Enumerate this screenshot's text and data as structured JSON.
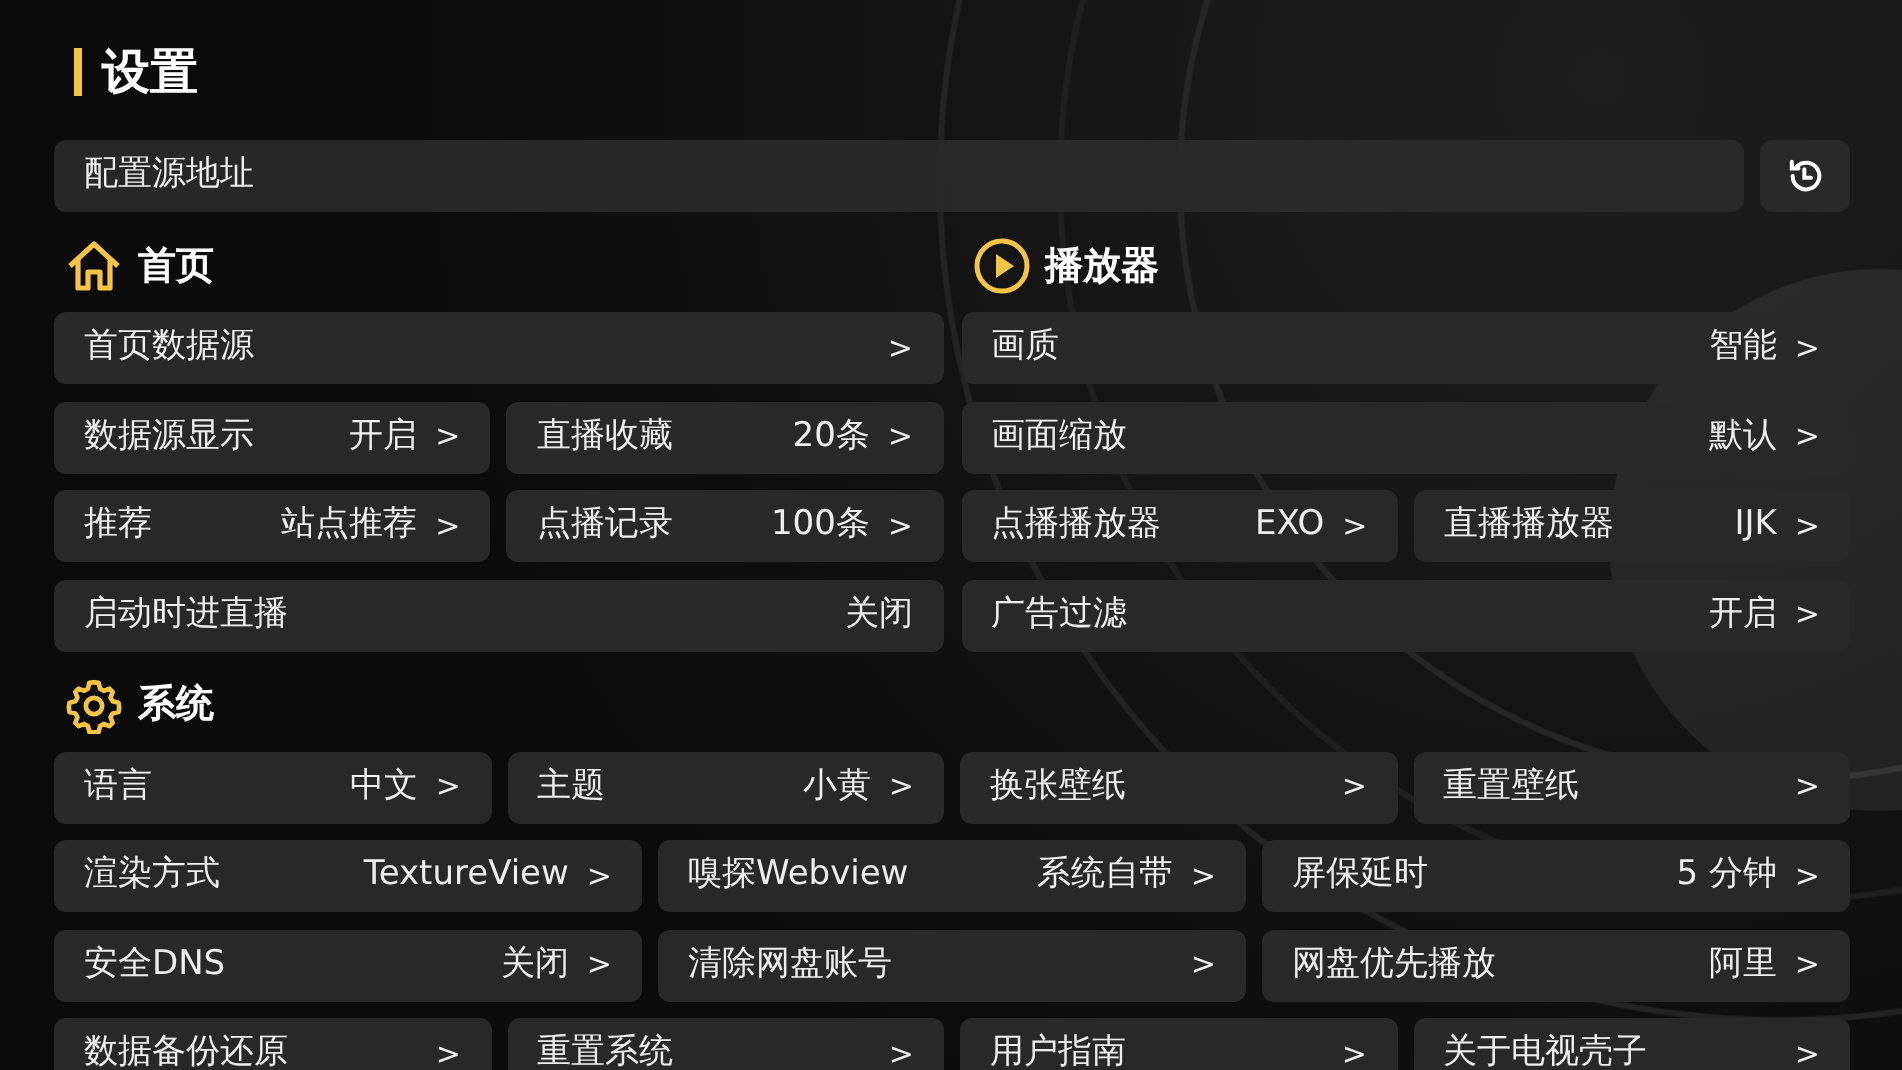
{
  "title": "设置",
  "config_source": {
    "label": "配置源地址"
  },
  "top_sections": [
    {
      "kind": "home",
      "title": "首页",
      "rows": [
        [
          {
            "label": "首页数据源",
            "arrow": ">"
          }
        ],
        [
          {
            "label": "数据源显示",
            "value": "开启",
            "arrow": ">"
          },
          {
            "label": "直播收藏",
            "value": "20条",
            "arrow": ">"
          }
        ],
        [
          {
            "label": "推荐",
            "value": "站点推荐",
            "arrow": ">"
          },
          {
            "label": "点播记录",
            "value": "100条",
            "arrow": ">"
          }
        ],
        [
          {
            "label": "启动时进直播",
            "value": "关闭"
          }
        ]
      ]
    },
    {
      "kind": "player",
      "title": "播放器",
      "rows": [
        [
          {
            "label": "画质",
            "value": "智能",
            "arrow": ">"
          }
        ],
        [
          {
            "label": "画面缩放",
            "value": "默认",
            "arrow": ">"
          }
        ],
        [
          {
            "label": "点播播放器",
            "value": "EXO",
            "arrow": ">"
          },
          {
            "label": "直播播放器",
            "value": "IJK",
            "arrow": ">"
          }
        ],
        [
          {
            "label": "广告过滤",
            "value": "开启",
            "arrow": ">"
          }
        ]
      ]
    }
  ],
  "system": {
    "kind": "system",
    "title": "系统",
    "rows": [
      [
        {
          "label": "语言",
          "value": "中文",
          "arrow": ">"
        },
        {
          "label": "主题",
          "value": "小黄",
          "arrow": ">"
        },
        {
          "label": "换张壁纸",
          "arrow": ">"
        },
        {
          "label": "重置壁纸",
          "arrow": ">"
        }
      ],
      [
        {
          "label": "渲染方式",
          "value": "TextureView",
          "arrow": ">"
        },
        {
          "label": "嗅探Webview",
          "value": "系统自带",
          "arrow": ">"
        },
        {
          "label": "屏保延时",
          "value": "5 分钟",
          "arrow": ">"
        }
      ],
      [
        {
          "label": "安全DNS",
          "value": "关闭",
          "arrow": ">"
        },
        {
          "label": "清除网盘账号",
          "arrow": ">"
        },
        {
          "label": "网盘优先播放",
          "value": "阿里",
          "arrow": ">"
        }
      ],
      [
        {
          "label": "数据备份还原",
          "arrow": ">"
        },
        {
          "label": "重置系统",
          "arrow": ">"
        },
        {
          "label": "用户指南",
          "arrow": ">"
        },
        {
          "label": "关于电视壳子",
          "arrow": ">"
        }
      ]
    ]
  }
}
